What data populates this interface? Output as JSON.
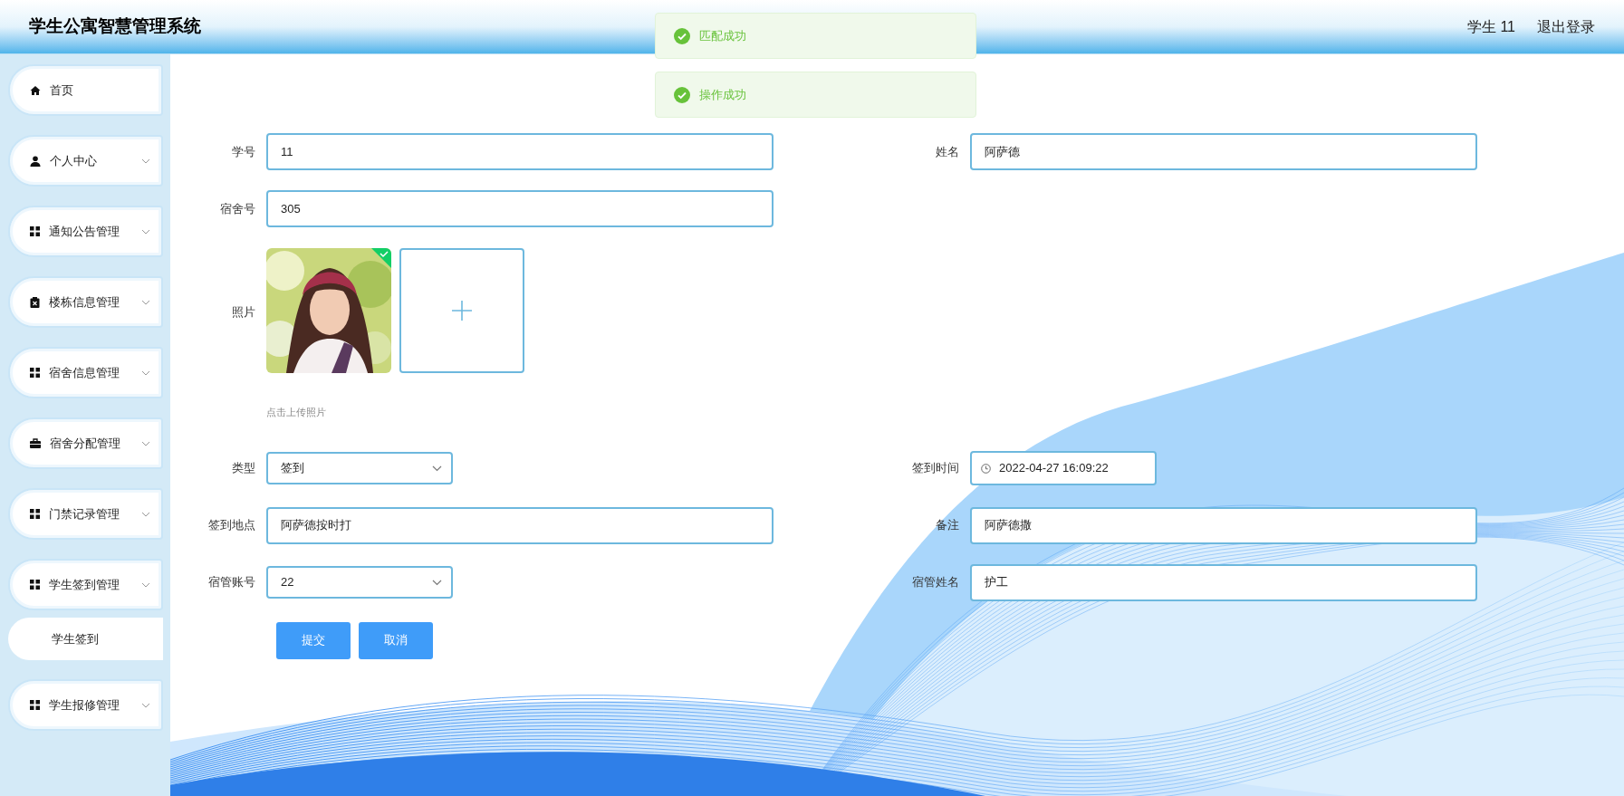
{
  "header": {
    "title": "学生公寓智慧管理系统",
    "user": "学生 11",
    "logout": "退出登录"
  },
  "toasts": [
    {
      "text": "匹配成功",
      "kind": "success"
    },
    {
      "text": "操作成功",
      "kind": "success"
    }
  ],
  "sidebar": {
    "items": [
      {
        "label": "首页",
        "submenu": false
      },
      {
        "label": "个人中心",
        "submenu": true
      },
      {
        "label": "通知公告管理",
        "submenu": true
      },
      {
        "label": "楼栋信息管理",
        "submenu": true
      },
      {
        "label": "宿舍信息管理",
        "submenu": true
      },
      {
        "label": "宿舍分配管理",
        "submenu": true
      },
      {
        "label": "门禁记录管理",
        "submenu": true
      },
      {
        "label": "学生签到管理",
        "submenu": true,
        "children": [
          {
            "label": "学生签到"
          }
        ]
      },
      {
        "label": "学生报修管理",
        "submenu": true
      }
    ]
  },
  "form": {
    "rows": [
      {
        "fields": [
          {
            "kind": "text",
            "label": "学号",
            "value": "11"
          },
          {
            "kind": "text",
            "label": "姓名",
            "value": "阿萨德"
          }
        ]
      },
      {
        "fields": [
          {
            "kind": "text",
            "label": "宿舍号",
            "value": "305"
          }
        ]
      },
      {
        "fields": [
          {
            "kind": "upload",
            "label": "照片",
            "hint": "点击上传照片",
            "uploaded": true
          }
        ]
      },
      {
        "fields": [
          {
            "kind": "select",
            "label": "类型",
            "value": "签到"
          },
          {
            "kind": "datetime",
            "label": "签到时间",
            "value": "2022-04-27 16:09:22"
          }
        ]
      },
      {
        "fields": [
          {
            "kind": "text",
            "label": "签到地点",
            "value": "阿萨德按时打"
          },
          {
            "kind": "text",
            "label": "备注",
            "value": "阿萨德撒"
          }
        ]
      },
      {
        "fields": [
          {
            "kind": "select",
            "label": "宿管账号",
            "value": "22"
          },
          {
            "kind": "text",
            "label": "宿管姓名",
            "value": "护工"
          }
        ]
      }
    ],
    "buttons": [
      "提交",
      "取消"
    ]
  }
}
